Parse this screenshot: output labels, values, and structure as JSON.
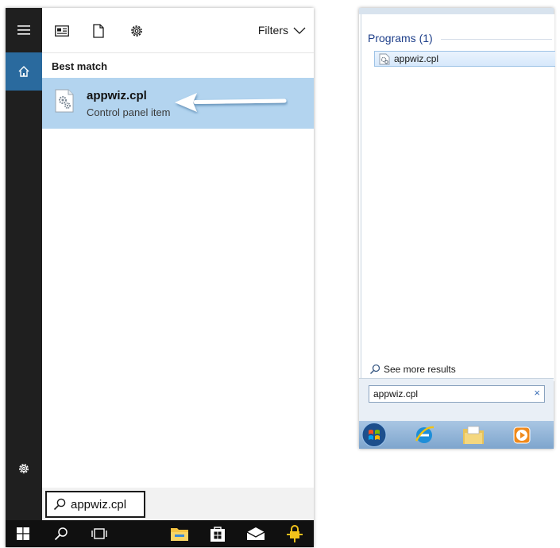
{
  "win10": {
    "toolbar": {
      "filters_label": "Filters"
    },
    "best_match_heading": "Best match",
    "result": {
      "name": "appwiz.cpl",
      "subtitle": "Control panel item"
    },
    "search": {
      "value": "appwiz.cpl"
    },
    "icons": {
      "hamburger": "hamburger-icon",
      "home": "home-icon",
      "settings": "gear-icon",
      "apps_filter": "apps-icon",
      "documents_filter": "document-icon",
      "settings_filter": "gear-icon",
      "filters_chevron": "chevron-down-icon",
      "result_icon": "control-panel-icon",
      "arrow": "arrow-left-icon",
      "taskbar": [
        "windows-start-icon",
        "search-icon",
        "task-view-icon",
        "file-explorer-icon",
        "store-icon",
        "mail-icon",
        "pinned-app-icon"
      ]
    },
    "colors": {
      "rail": "#1f1f1f",
      "home_active": "#2a6a9e",
      "selected": "#b3d4ef",
      "taskbar": "#101010"
    }
  },
  "win7": {
    "programs_heading": "Programs (1)",
    "program_item": "appwiz.cpl",
    "see_more": "See more results",
    "search": {
      "value": "appwiz.cpl",
      "clear": "×"
    },
    "icons": {
      "item": "control-panel-icon",
      "see_more": "search-icon",
      "taskbar": [
        "windows-orb-icon",
        "internet-explorer-icon",
        "windows-explorer-icon",
        "media-player-icon"
      ]
    },
    "colors": {
      "heading": "#1e3f8a",
      "taskbar": "#7ea5cd"
    }
  }
}
